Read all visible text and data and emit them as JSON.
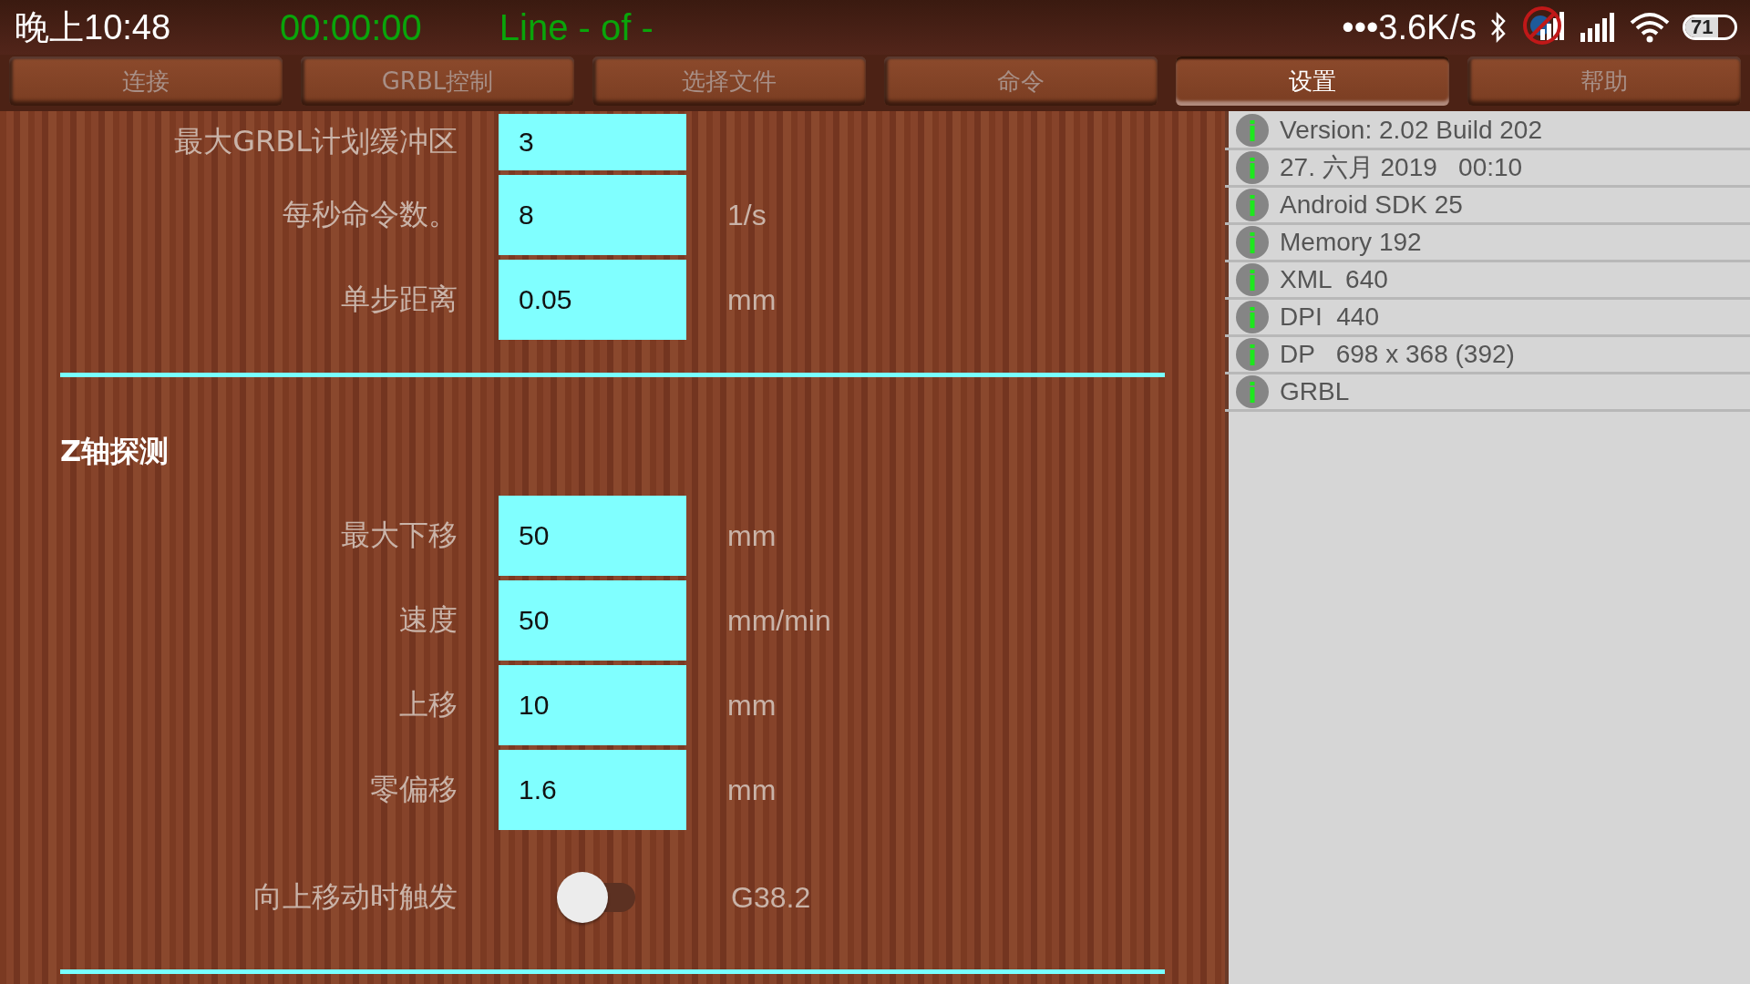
{
  "status_bar": {
    "time": "晚上10:48",
    "timer": "00:00:00",
    "line": "Line - of -",
    "speed": "•••3.6K/s",
    "battery": "71"
  },
  "tabs": [
    {
      "label": "连接",
      "selected": false
    },
    {
      "label": "GRBL控制",
      "selected": false
    },
    {
      "label": "选择文件",
      "selected": false
    },
    {
      "label": "命令",
      "selected": false
    },
    {
      "label": "设置",
      "selected": true
    },
    {
      "label": "帮助",
      "selected": false
    }
  ],
  "settings": {
    "rows": [
      {
        "kind": "field",
        "label": "最大GRBL计划缓冲区",
        "value": "3"
      },
      {
        "kind": "field",
        "label": "每秒命令数。",
        "value": "8",
        "unit": "1/s"
      },
      {
        "kind": "field",
        "label": "单步距离",
        "value": "0.05",
        "unit": "mm"
      }
    ]
  },
  "z_probe": {
    "heading": "Z轴探测",
    "rows": [
      {
        "kind": "field",
        "label": "最大下移",
        "value": "50",
        "unit": "mm"
      },
      {
        "kind": "field",
        "label": "速度",
        "value": "50",
        "unit": "mm/min"
      },
      {
        "kind": "field",
        "label": "上移",
        "value": "10",
        "unit": "mm"
      },
      {
        "kind": "field",
        "label": "零偏移",
        "value": "1.6",
        "unit": "mm"
      },
      {
        "kind": "toggle",
        "label": "向上移动时触发",
        "on": false,
        "unit": "G38.2"
      }
    ]
  },
  "info_list": [
    "Version: 2.02 Build 202",
    "27. 六月 2019   00:10",
    "Android SDK 25",
    "Memory 192",
    "XML  640",
    "DPI  440",
    "DP   698 x 368 (392)",
    "GRBL"
  ]
}
